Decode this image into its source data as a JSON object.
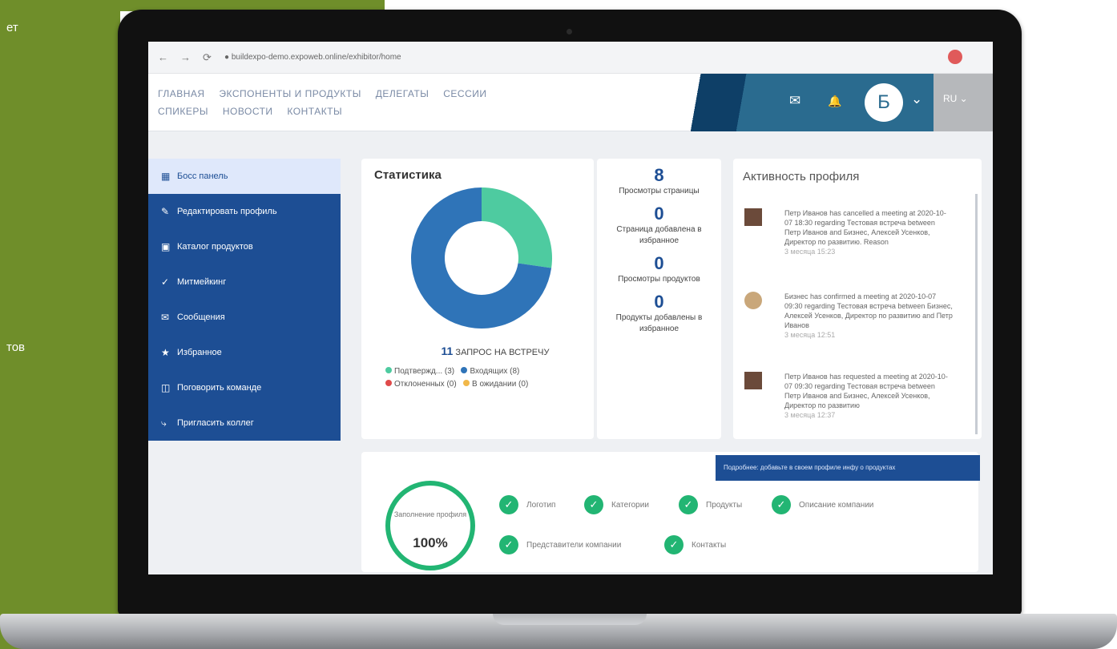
{
  "outer": {
    "side_fragments": [
      "ет",
      "тов"
    ]
  },
  "browser": {
    "nav_icons": [
      "←",
      "→",
      "⟳"
    ],
    "url": "●  buildexpo-demo.expoweb.online/exhibitor/home"
  },
  "header": {
    "nav_items": [
      "ГЛАВНАЯ",
      "ЭКСПОНЕНТЫ И ПРОДУКТЫ",
      "ДЕЛЕГАТЫ",
      "СЕССИИ",
      "СПИКЕРЫ",
      "НОВОСТИ",
      "КОНТАКТЫ"
    ],
    "mail_icon": "✉",
    "bell_icon": "🔔",
    "user_initial": "Б",
    "user_chevron": "⌄",
    "lang": "RU ⌄"
  },
  "sidebar": {
    "items": [
      {
        "icon": "▦",
        "label": "Босс панель",
        "active": true
      },
      {
        "icon": "✎",
        "label": "Редактировать профиль"
      },
      {
        "icon": "▣",
        "label": "Каталог продуктов"
      },
      {
        "icon": "✓",
        "label": "Митмейкинг"
      },
      {
        "icon": "✉",
        "label": "Сообщения"
      },
      {
        "icon": "★",
        "label": "Избранное"
      },
      {
        "icon": "◫",
        "label": "Поговорить команде"
      },
      {
        "icon": "⤷",
        "label": "Пригласить коллег"
      }
    ]
  },
  "stats": {
    "title": "Статистика",
    "center_label": "11 запрос на встречу",
    "total_meetings": "11",
    "meetings_label": "ЗАПРОС НА ВСТРЕЧУ",
    "legend": [
      {
        "label": "Подтвержд... (3)",
        "color": "#4ecba0"
      },
      {
        "label": "Входящих (8)",
        "color": "#2f74b8"
      },
      {
        "label": "Отклоненных (0)",
        "color": "#e04a4a"
      },
      {
        "label": "В ожидании (0)",
        "color": "#f1b84a"
      }
    ]
  },
  "chart_data": {
    "type": "pie",
    "categories": [
      "Подтвержд...",
      "Входящих",
      "Отклоненных",
      "В ожидании"
    ],
    "values": [
      3,
      8,
      0,
      0
    ],
    "colors": [
      "#4ecba0",
      "#2f74b8",
      "#e04a4a",
      "#f1b84a"
    ]
  },
  "metrics": [
    {
      "value": "8",
      "label": "Просмотры страницы"
    },
    {
      "value": "0",
      "label": "Страница добавлена в избранное"
    },
    {
      "value": "0",
      "label": "Просмотры продуктов"
    },
    {
      "value": "0",
      "label": "Продукты добавлены в избранное"
    }
  ],
  "activity": {
    "title": "Активность профиля",
    "items": [
      {
        "text": "Петр Иванов has cancelled a meeting at 2020-10-07 18:30 regarding Тестовая встреча between Петр Иванов and Бизнес, Алексей Усенков, Директор по развитию. Reason",
        "time": "3 месяца 15:23"
      },
      {
        "text": "Бизнес has confirmed a meeting at 2020-10-07 09:30 regarding Тестовая встреча between Бизнес, Алексей Усенков, Директор по развитию and Петр Иванов",
        "time": "3 месяца 12:51"
      },
      {
        "text": "Петр Иванов has requested a meeting at 2020-10-07 09:30 regarding Тестовая встреча between Петр Иванов and Бизнес, Алексей Усенков, Директор по развитию",
        "time": "3 месяца 12:37"
      }
    ]
  },
  "completion": {
    "ring_label": "Заполнение профиля",
    "ring_value": "100%",
    "notice": "Подробнее: добавьте в своем профиле инфу о продуктах",
    "checks": [
      "Логотип",
      "Категории",
      "Продукты",
      "Описание компании",
      "Представители компании",
      "Контакты"
    ]
  }
}
